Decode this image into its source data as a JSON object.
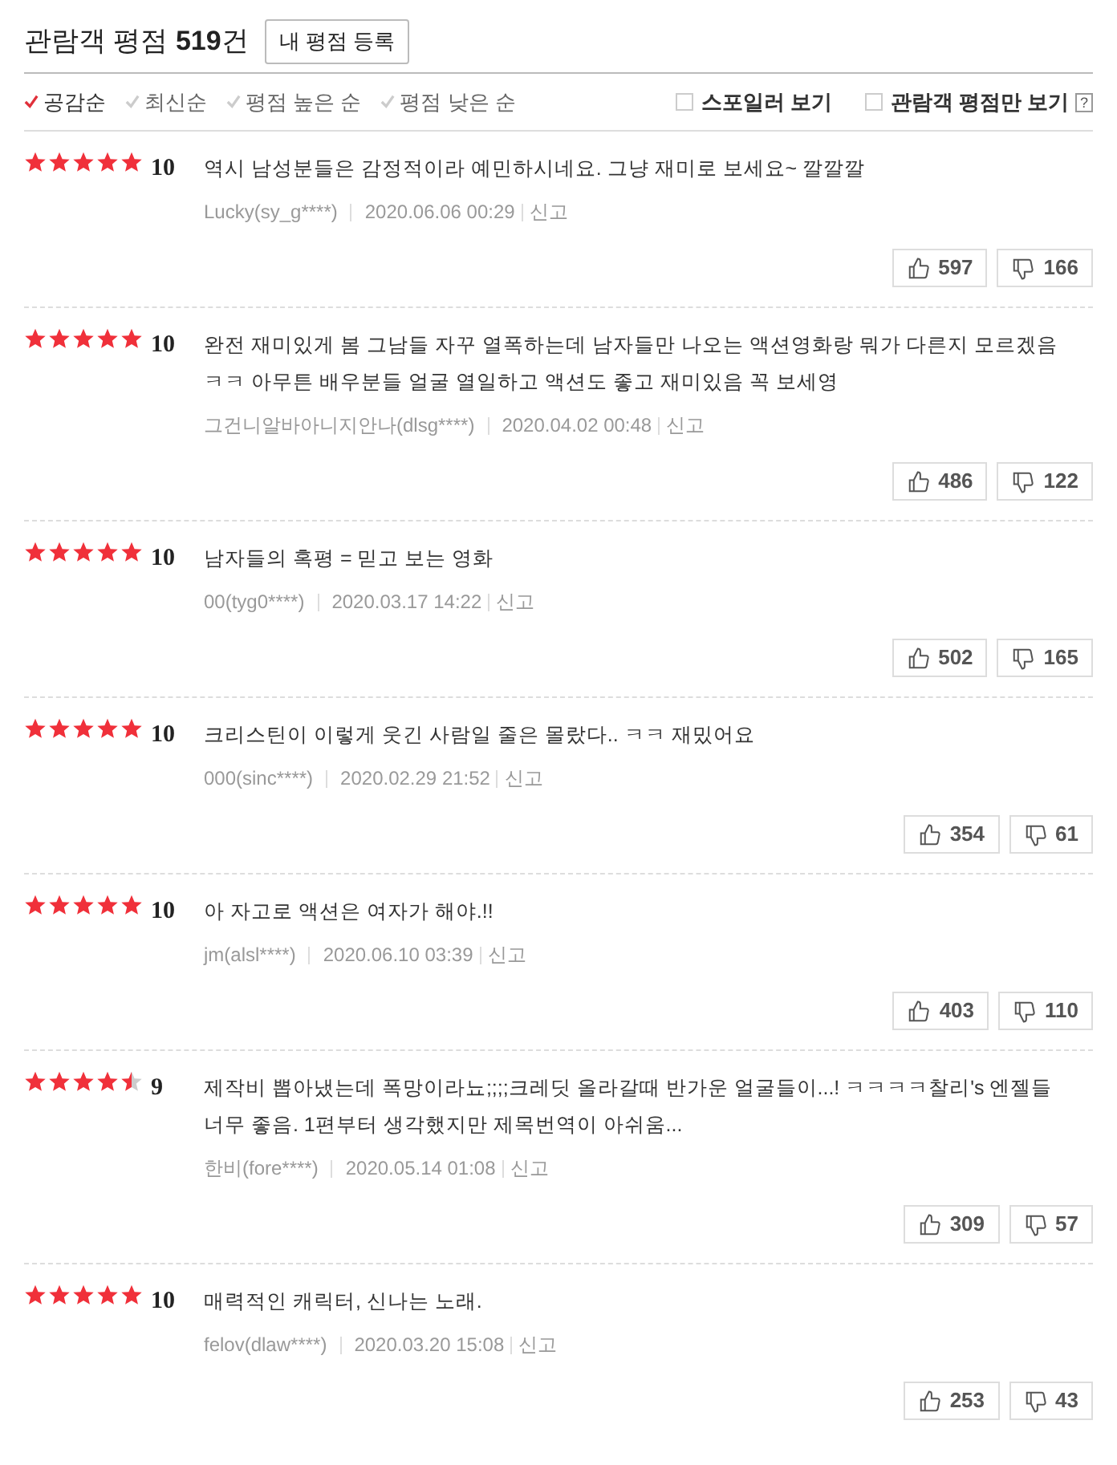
{
  "header": {
    "title": "관람객 평점 **519**건",
    "register_button": "내 평점 등록"
  },
  "sort_options": [
    {
      "label": "공감순",
      "selected": true
    },
    {
      "label": "최신순",
      "selected": false
    },
    {
      "label": "평점 높은 순",
      "selected": false
    },
    {
      "label": "평점 낮은 순",
      "selected": false
    }
  ],
  "filters": [
    {
      "label": "스포일러 보기",
      "checked": false
    },
    {
      "label": "관람객 평점만 보기",
      "checked": false,
      "help": "?"
    }
  ],
  "reviews": [
    {
      "stars": 5,
      "score": "10",
      "text": "역시 남성분들은 감정적이라 예민하시네요. 그냥 재미로 보세요~ 깔깔깔",
      "author": "Lucky(sy_g****)",
      "date": "2020.06.06 00:29",
      "report": "신고",
      "likes": "597",
      "dislikes": "166"
    },
    {
      "stars": 5,
      "score": "10",
      "text": "완전 재미있게 봄 그남들 자꾸 열폭하는데 남자들만 나오는 액션영화랑 뭐가 다른지 모르겠음 ㅋㅋ 아무튼 배우분들 얼굴 열일하고 액션도 좋고 재미있음 꼭 보세영",
      "author": "그건니알바아니지안나(dlsg****)",
      "date": "2020.04.02 00:48",
      "report": "신고",
      "likes": "486",
      "dislikes": "122"
    },
    {
      "stars": 5,
      "score": "10",
      "text": "남자들의 혹평 = 믿고 보는 영화",
      "author": "00(tyg0****)",
      "date": "2020.03.17 14:22",
      "report": "신고",
      "likes": "502",
      "dislikes": "165"
    },
    {
      "stars": 5,
      "score": "10",
      "text": "크리스틴이 이렇게 웃긴 사람일 줄은 몰랐다.. ㅋㅋ 재밌어요",
      "author": "000(sinc****)",
      "date": "2020.02.29 21:52",
      "report": "신고",
      "likes": "354",
      "dislikes": "61"
    },
    {
      "stars": 5,
      "score": "10",
      "text": "아 자고로 액션은 여자가 해야.!!",
      "author": "jm(alsl****)",
      "date": "2020.06.10 03:39",
      "report": "신고",
      "likes": "403",
      "dislikes": "110"
    },
    {
      "stars": 4.5,
      "score": "9",
      "text": "제작비 뽑아냈는데 폭망이라뇨;;;;크레딧 올라갈때 반가운 얼굴들이...! ㅋㅋㅋㅋ찰리's 엔젤들 너무 좋음. 1편부터 생각했지만 제목번역이 아쉬움...",
      "author": "한비(fore****)",
      "date": "2020.05.14 01:08",
      "report": "신고",
      "likes": "309",
      "dislikes": "57"
    },
    {
      "stars": 5,
      "score": "10",
      "text": "매력적인 캐릭터, 신나는 노래.",
      "author": "felov(dlaw****)",
      "date": "2020.03.20 15:08",
      "report": "신고",
      "likes": "253",
      "dislikes": "43"
    }
  ]
}
